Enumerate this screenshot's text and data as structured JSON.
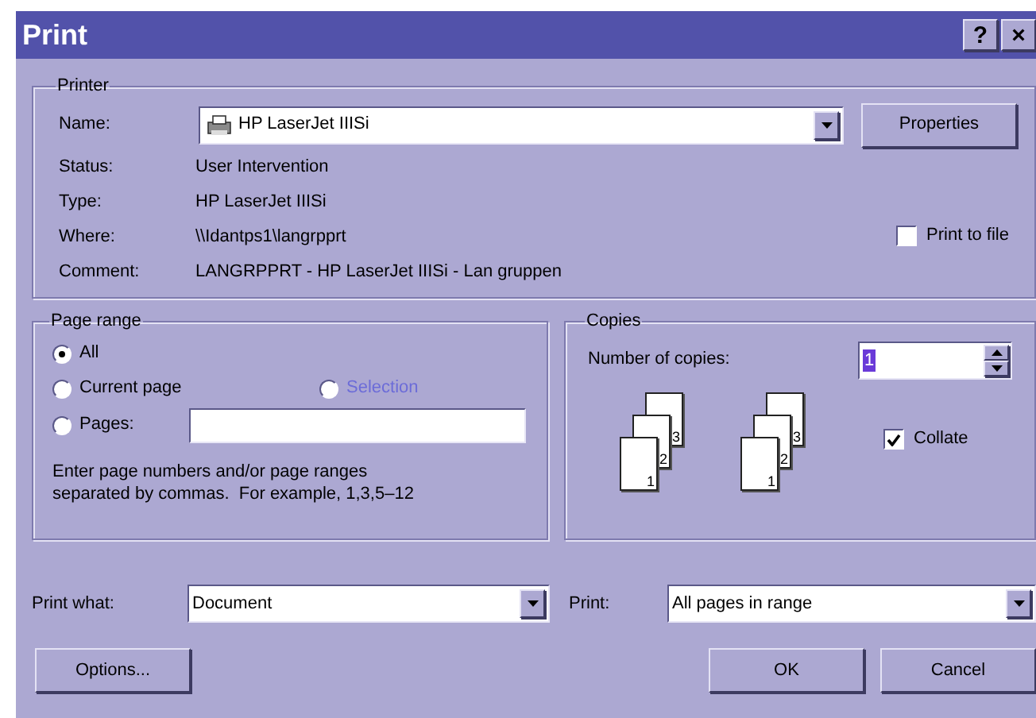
{
  "window": {
    "title": "Print",
    "help_button": "?",
    "close_button": "×"
  },
  "printer": {
    "group_label": "Printer",
    "name_label": "Name:",
    "name_value": "HP LaserJet IIISi",
    "properties_button": "Properties",
    "details": [
      {
        "label": "Status:",
        "value": "User Intervention"
      },
      {
        "label": "Type:",
        "value": "HP LaserJet IIISi"
      },
      {
        "label": "Where:",
        "value": "\\\\Idantps1\\langrpprt"
      },
      {
        "label": "Comment:",
        "value": "LANGRPPRT - HP LaserJet IIISi - Lan gruppen"
      }
    ],
    "print_to_file": {
      "label": "Print to file",
      "checked": false
    }
  },
  "page_range": {
    "group_label": "Page range",
    "options": [
      {
        "label": "All",
        "selected": true,
        "disabled": false
      },
      {
        "label": "Current page",
        "selected": false,
        "disabled": false
      },
      {
        "label": "Selection",
        "selected": false,
        "disabled": true
      },
      {
        "label": "Pages:",
        "selected": false,
        "disabled": false
      }
    ],
    "hint": "Enter page numbers and/or page ranges separated by commas.  For example, 1,3,5–12"
  },
  "copies": {
    "group_label": "Copies",
    "number_label": "Number of copies:",
    "number_value": "1",
    "stacks": [
      {
        "pages": [
          "3",
          "2",
          "1"
        ]
      },
      {
        "pages": [
          "3",
          "2",
          "1"
        ]
      }
    ],
    "collate": {
      "label": "Collate",
      "checked": true
    }
  },
  "print_what": {
    "label": "Print what:",
    "value": "Document"
  },
  "print": {
    "label": "Print:",
    "value": "All pages in range"
  },
  "buttons": [
    "Options...",
    "OK",
    "Cancel"
  ]
}
